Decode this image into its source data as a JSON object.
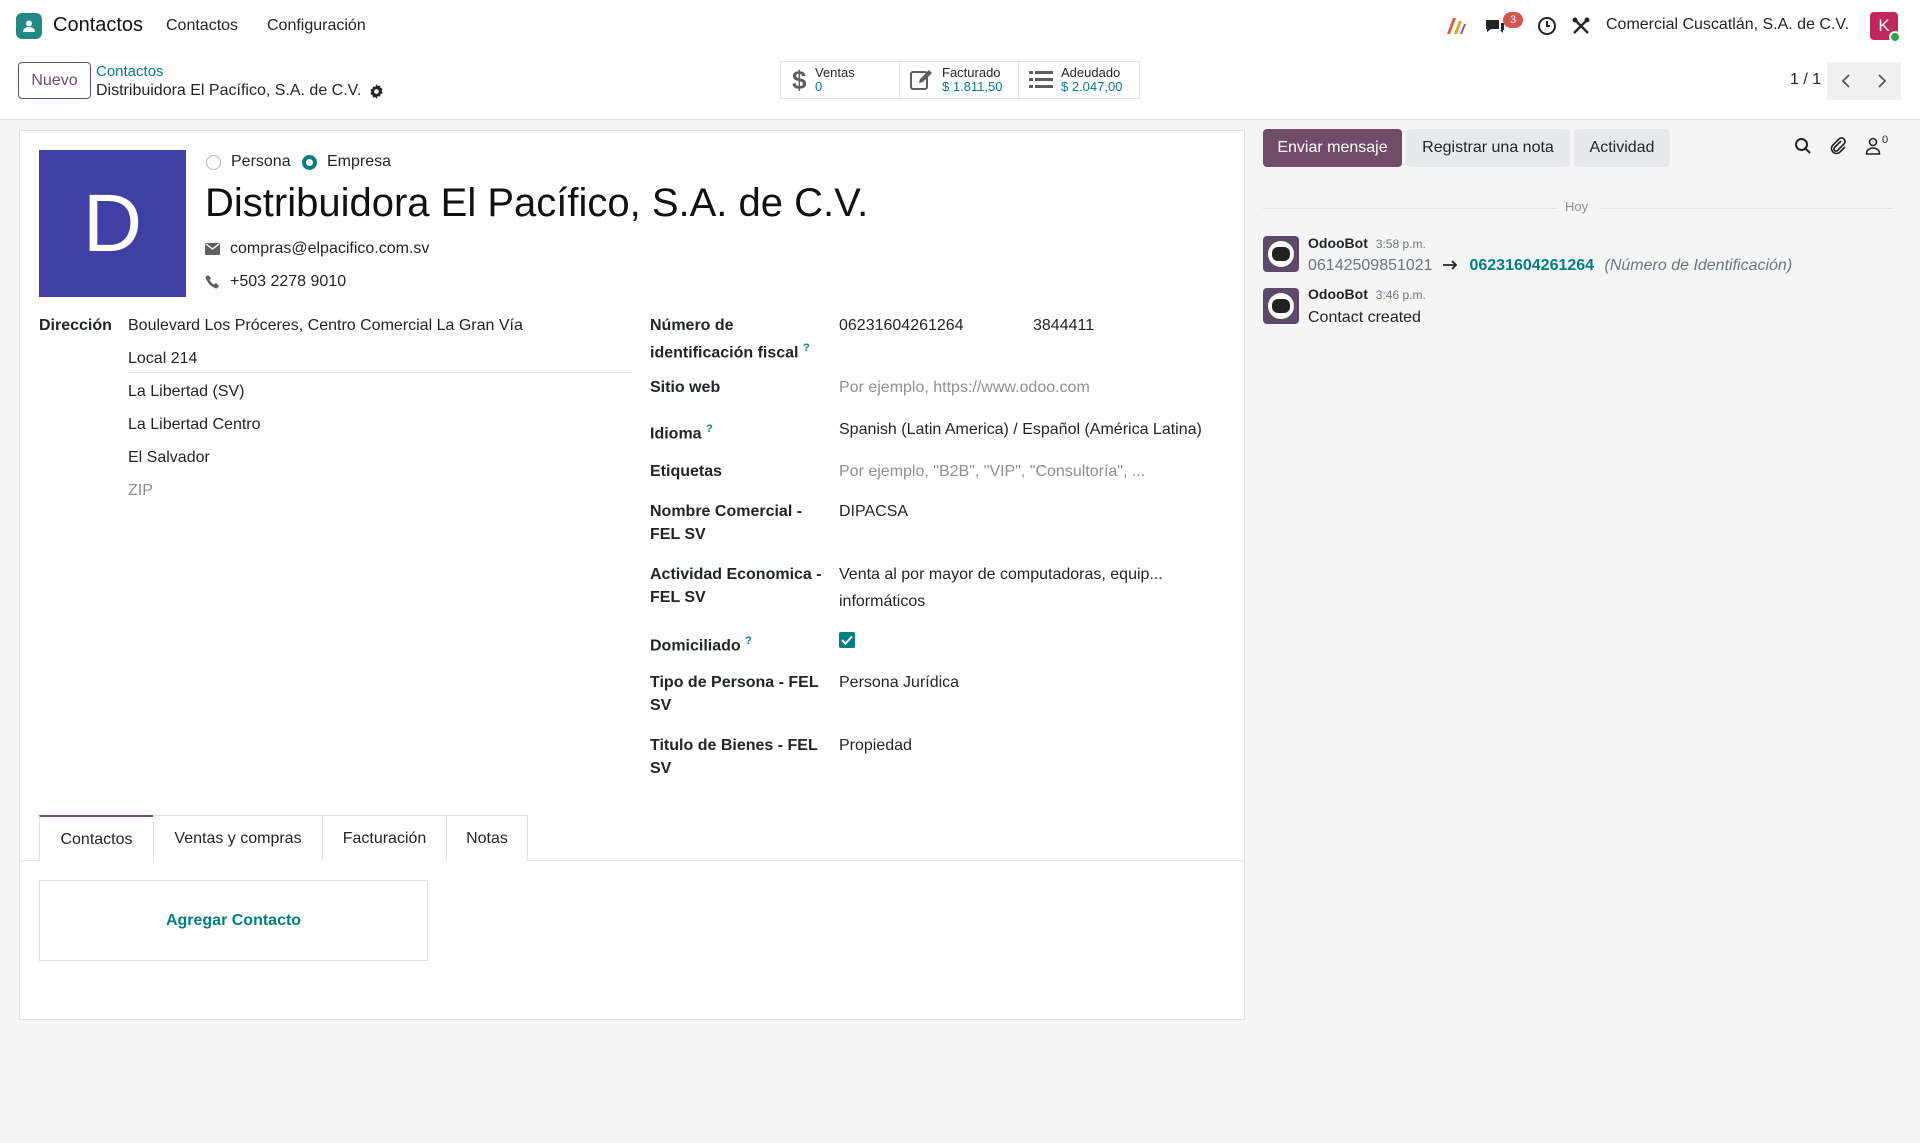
{
  "app": {
    "name": "Contactos"
  },
  "nav": {
    "menu_contactos": "Contactos",
    "menu_configuracion": "Configuración"
  },
  "systray": {
    "messages_count": "3",
    "company": "Comercial Cuscatlán, S.A. de C.V.",
    "user_initial": "K"
  },
  "control": {
    "new_button": "Nuevo",
    "breadcrumb_parent": "Contactos",
    "breadcrumb_current": "Distribuidora El Pacífico, S.A. de C.V.",
    "smart_buttons": [
      {
        "label": "Ventas",
        "value": "0"
      },
      {
        "label": "Facturado",
        "value": "$ 1.811,50"
      },
      {
        "label": "Adeudado",
        "value": "$ 2.047,00"
      }
    ],
    "pager": "1 / 1"
  },
  "form": {
    "avatar_letter": "D",
    "type_persona": "Persona",
    "type_empresa": "Empresa",
    "name": "Distribuidora El Pacífico, S.A. de C.V.",
    "email": "compras@elpacifico.com.sv",
    "phone": "+503 2278 9010",
    "address_label": "Dirección",
    "address": {
      "street": "Boulevard Los Próceres, Centro Comercial La Gran Vía",
      "street2": "Local 214",
      "city": "La Libertad (SV)",
      "state": "La Libertad Centro",
      "country": "El Salvador",
      "zip_placeholder": "ZIP"
    },
    "fields": {
      "nit_label_1": "Número de",
      "nit_label_2": "identificación fiscal",
      "nit_value": "06231604261264",
      "nit_extra": "3844411",
      "website_label": "Sitio web",
      "website_placeholder": "Por ejemplo, https://www.odoo.com",
      "lang_label": "Idioma",
      "lang_value": "Spanish (Latin America) / Español (América Latina)",
      "tags_label": "Etiquetas",
      "tags_placeholder": "Por ejemplo, \"B2B\", \"VIP\", \"Consultoría\", ...",
      "trade_name_label_1": "Nombre Comercial -",
      "trade_name_label_2": "FEL SV",
      "trade_name_value": "DIPACSA",
      "activity_label_1": "Actividad Economica -",
      "activity_label_2": "FEL SV",
      "activity_value_1": "Venta al por mayor de computadoras, equip...",
      "activity_value_2": "informáticos",
      "domiciled_label": "Domiciliado",
      "person_type_label_1": "Tipo de Persona - FEL",
      "person_type_label_2": "SV",
      "person_type_value": "Persona Jurídica",
      "title_goods_label_1": "Titulo de Bienes - FEL",
      "title_goods_label_2": "SV",
      "title_goods_value": "Propiedad",
      "help_mark": "?"
    },
    "tabs": [
      "Contactos",
      "Ventas y compras",
      "Facturación",
      "Notas"
    ],
    "add_contact": "Agregar Contacto"
  },
  "chatter": {
    "send_message": "Enviar mensaje",
    "log_note": "Registrar una nota",
    "activity": "Actividad",
    "followers_count": "0",
    "date_separator": "Hoy",
    "messages": [
      {
        "author": "OdooBot",
        "time": "3:58 p.m.",
        "old_value": "06142509851021",
        "new_value": "06231604261264",
        "field": "(Número de Identificación)"
      },
      {
        "author": "OdooBot",
        "time": "3:46 p.m.",
        "body": "Contact created"
      }
    ]
  },
  "colors": {
    "brand": "#714b67",
    "link": "#017e84",
    "avatar_d": "#3f3fa6",
    "avatar_k": "#c0275c"
  }
}
